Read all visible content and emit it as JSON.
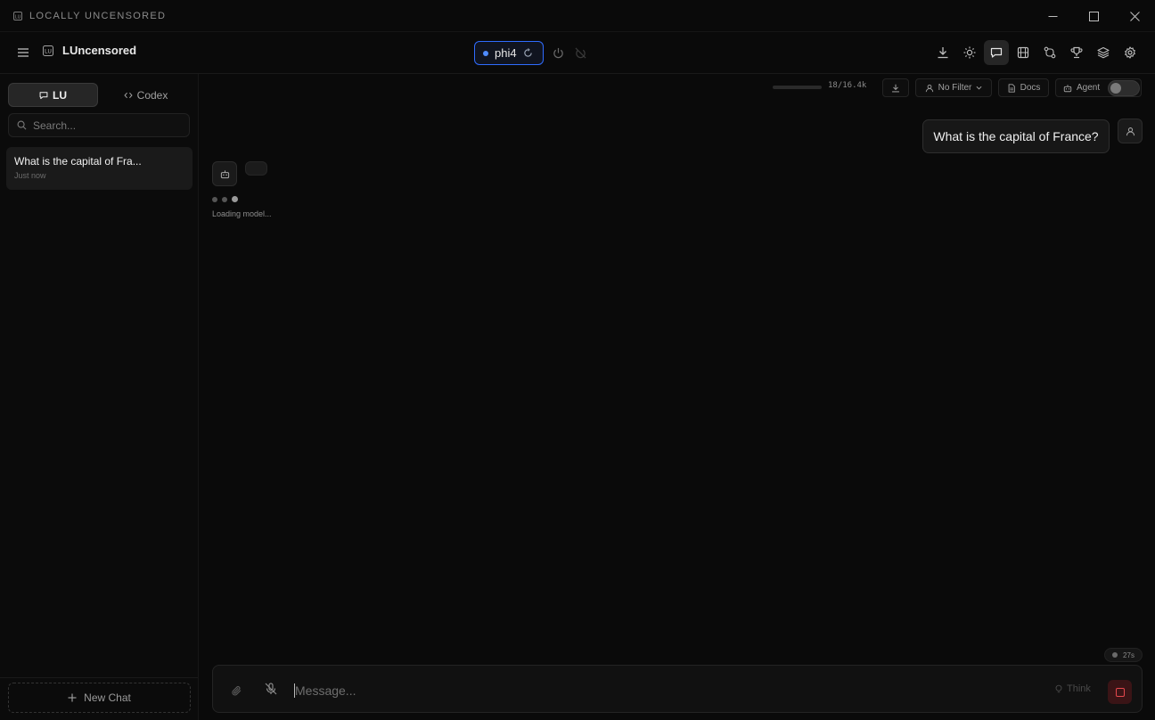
{
  "window": {
    "title": "LOCALLY UNCENSORED"
  },
  "header": {
    "brand_label": "LUncensored",
    "model": "phi4"
  },
  "sidebar": {
    "tabs": [
      {
        "label": "LU"
      },
      {
        "label": "Codex"
      }
    ],
    "search_placeholder": "Search...",
    "chats": [
      {
        "title": "What is the capital of Fra...",
        "time": "Just now"
      }
    ],
    "new_chat_label": "New Chat"
  },
  "toolbar": {
    "token_count": "18/16.4k",
    "token_fill": 0.001,
    "filter_label": "No Filter",
    "docs_label": "Docs",
    "agent_label": "Agent",
    "agent_enabled": false
  },
  "messages": {
    "user_text": "What is the capital of France?",
    "status_text": "Loading model..."
  },
  "composer": {
    "placeholder": "Message...",
    "elapsed": "27s",
    "think_label": "Think"
  },
  "colors": {
    "accent": "#2f6cff",
    "stop": "#e5484d",
    "background": "#0a0a0a"
  },
  "icons": {
    "header": [
      "download-icon",
      "sun-icon",
      "chat-icon",
      "film-icon",
      "workflow-icon",
      "trophy-icon",
      "layers-icon",
      "gear-icon"
    ]
  }
}
